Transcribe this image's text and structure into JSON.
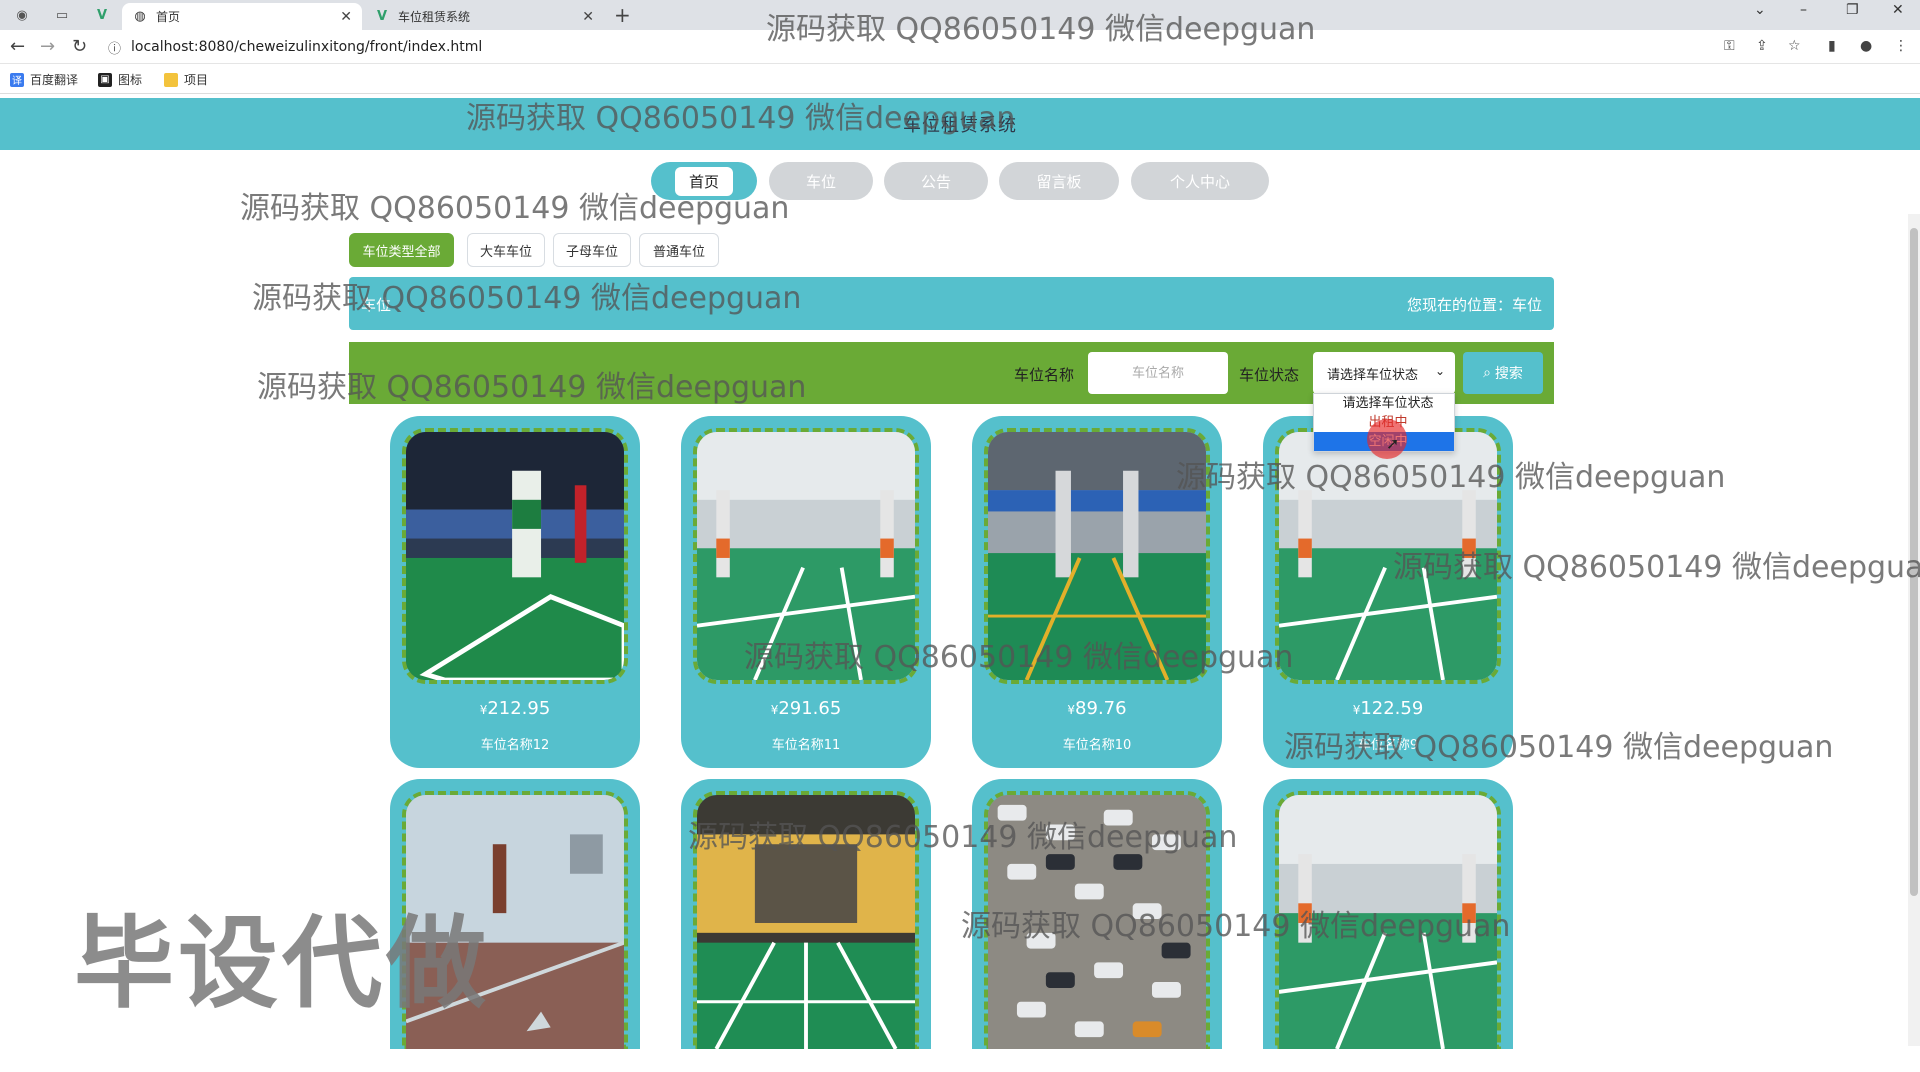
{
  "browser": {
    "tabs": [
      {
        "title": "首页",
        "icon": "globe-icon",
        "active": true
      },
      {
        "title": "车位租赁系统",
        "icon": "vue-icon",
        "active": false
      }
    ],
    "url": "localhost:8080/cheweizulinxitong/front/index.html",
    "bookmarks": [
      {
        "label": "百度翻译",
        "icon": "translate-icon",
        "color": "#3a7bef"
      },
      {
        "label": "图标",
        "icon": "image-icon",
        "color": "#222222"
      },
      {
        "label": "项目",
        "icon": "folder-icon",
        "color": "#f3c33c"
      }
    ]
  },
  "site": {
    "title": "车位租赁系统",
    "nav": [
      "首页",
      "车位",
      "公告",
      "留言板",
      "个人中心"
    ],
    "active_nav": "首页"
  },
  "filters": [
    "车位类型全部",
    "大车车位",
    "子母车位",
    "普通车位"
  ],
  "breadcrumb": {
    "title": "车位",
    "location": "您现在的位置：车位"
  },
  "search": {
    "name_label": "车位名称",
    "name_placeholder": "车位名称",
    "status_label": "车位状态",
    "status_value": "请选择车位状态",
    "button": "搜索",
    "options": [
      "请选择车位状态",
      "出租中",
      "空闲中"
    ],
    "highlighted_option": "空闲中"
  },
  "cards": [
    {
      "price": "212.95",
      "name": "车位名称12",
      "currency": "¥"
    },
    {
      "price": "291.65",
      "name": "车位名称11",
      "currency": "¥"
    },
    {
      "price": "89.76",
      "name": "车位名称10",
      "currency": "¥"
    },
    {
      "price": "122.59",
      "name": "车位名称9",
      "currency": "¥"
    },
    {
      "price": "",
      "name": "",
      "currency": ""
    },
    {
      "price": "",
      "name": "",
      "currency": ""
    },
    {
      "price": "",
      "name": "",
      "currency": ""
    },
    {
      "price": "",
      "name": "",
      "currency": ""
    }
  ],
  "watermarks": {
    "text": "源码获取 QQ86050149 微信deepguan",
    "big": "毕设代做"
  },
  "colors": {
    "teal": "#55c0cc",
    "green": "#6aaa36",
    "nav_inactive": "#d2d5d8"
  }
}
